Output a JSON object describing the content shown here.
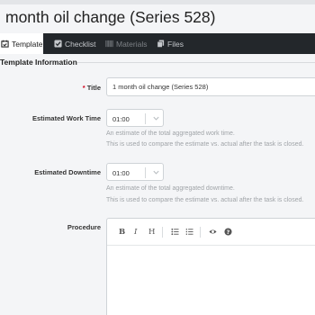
{
  "header": {
    "title": "month oil change (Series 528)"
  },
  "tabs": [
    {
      "label": "Template",
      "active": true
    },
    {
      "label": "Checklist"
    },
    {
      "label": "Materials"
    },
    {
      "label": "Files"
    }
  ],
  "form": {
    "section_title": "Template Information",
    "title_field": {
      "label": "Title",
      "required_mark": "*",
      "value": "1 month oil change (Series 528)"
    },
    "work_time": {
      "label": "Estimated Work Time",
      "value": "01:00",
      "help1": "An estimate of the total aggregated work time.",
      "help2": "This is used to compare the estimate vs. actual after the task is closed."
    },
    "downtime": {
      "label": "Estimated Downtime",
      "value": "01:00",
      "help1": "An estimate of the total aggregated downtime.",
      "help2": "This is used to compare the estimate vs. actual after the task is closed."
    },
    "procedure": {
      "label": "Procedure",
      "toolbar": {
        "bold": "B",
        "italic": "I",
        "heading": "H"
      }
    }
  },
  "colors": {
    "tabbar_bg": "#23272b",
    "required": "#d0021b",
    "help_text": "#a0a4a8"
  },
  "icons": {
    "template_tab": "calendar-check-icon",
    "checklist_tab": "checkbox-icon",
    "materials_tab": "barcode-icon",
    "files_tab": "files-icon",
    "select_toggle": "chevron-down-icon",
    "bulleted_list": "bulleted-list-icon",
    "numbered_list": "numbered-list-icon",
    "preview": "eye-icon",
    "help": "question-circle-icon"
  }
}
